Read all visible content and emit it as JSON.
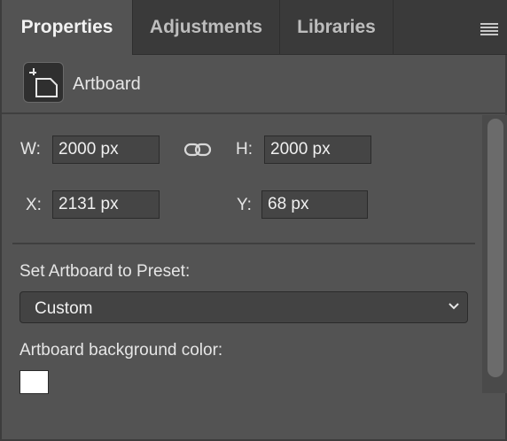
{
  "tabs": [
    {
      "label": "Properties",
      "active": true
    },
    {
      "label": "Adjustments",
      "active": false
    },
    {
      "label": "Libraries",
      "active": false
    }
  ],
  "panel_menu_icon": "hamburger-icon",
  "header": {
    "icon": "artboard-icon",
    "label": "Artboard"
  },
  "size": {
    "w_label": "W:",
    "w_value": "2000 px",
    "h_label": "H:",
    "h_value": "2000 px",
    "link_icon": "chain-link-icon"
  },
  "position": {
    "x_label": "X:",
    "x_value": "2131 px",
    "y_label": "Y:",
    "y_value": "68 px"
  },
  "preset": {
    "label": "Set Artboard to Preset:",
    "value": "Custom"
  },
  "background": {
    "label": "Artboard background color:",
    "color": "#ffffff"
  }
}
